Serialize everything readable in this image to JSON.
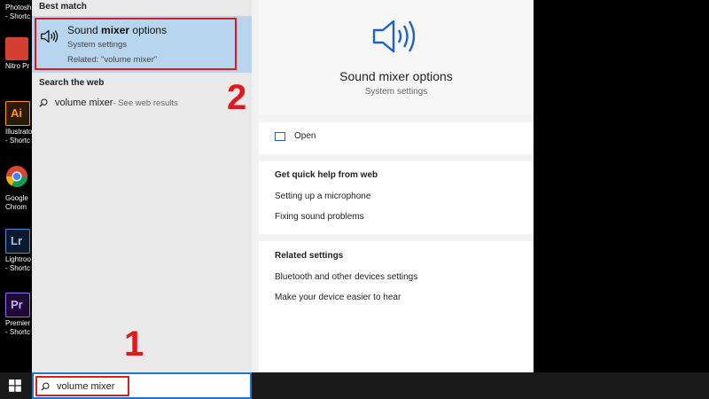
{
  "desktop": {
    "icons": [
      {
        "label": "Photosh\n- Shortc",
        "color": "#3d6ea8"
      },
      {
        "label": "Nitro Pr",
        "color": "#d4402f"
      },
      {
        "label": "Illustrato\n- Shortc",
        "color": "#ff9a00"
      },
      {
        "label": "Google\nChrom",
        "color": "#ffffff"
      },
      {
        "label": "Lightroo\n- Shortc",
        "color": "#2f4a76"
      },
      {
        "label": "Premier\n- Shortc",
        "color": "#7a4dd6"
      }
    ]
  },
  "left_panel": {
    "best_match_heading": "Best match",
    "best_match": {
      "title_prefix": "Sound ",
      "title_bold": "mixer",
      "title_suffix": " options",
      "subtitle": "System settings",
      "related": "Related: \"volume mixer\""
    },
    "search_web_heading": "Search the web",
    "web_item_query": "volume mixer",
    "web_item_suffix": " - See web results"
  },
  "right_panel": {
    "title": "Sound mixer options",
    "subtitle": "System settings",
    "open_label": "Open",
    "quick_help_heading": "Get quick help from web",
    "quick_help_items": [
      "Setting up a microphone",
      "Fixing sound problems"
    ],
    "related_heading": "Related settings",
    "related_items": [
      "Bluetooth and other devices settings",
      "Make your device easier to hear"
    ]
  },
  "steps": {
    "one": "1",
    "two": "2"
  },
  "taskbar": {
    "search_value": "volume mixer"
  },
  "colors": {
    "accent": "#1a76d2",
    "highlight_red": "#e0191f",
    "selection": "#b7d6ee"
  }
}
